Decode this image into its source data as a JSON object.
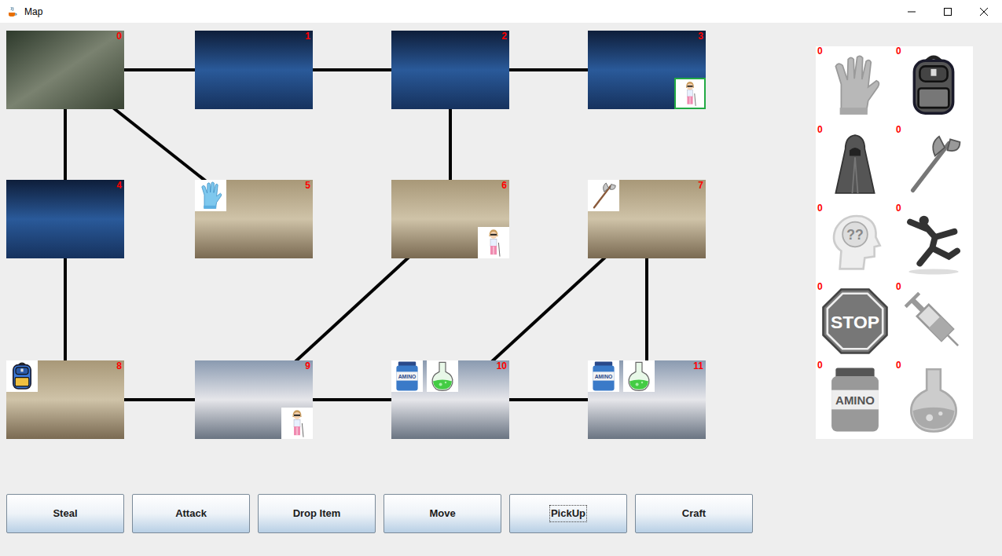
{
  "window": {
    "title": "Map"
  },
  "map": {
    "rooms": [
      {
        "number": "0",
        "kind": "city",
        "items": [],
        "players": []
      },
      {
        "number": "1",
        "kind": "lab",
        "items": [],
        "players": []
      },
      {
        "number": "2",
        "kind": "lab",
        "items": [],
        "players": []
      },
      {
        "number": "3",
        "kind": "lab",
        "items": [],
        "players": [
          {
            "selected": true
          }
        ]
      },
      {
        "number": "4",
        "kind": "lab",
        "items": [],
        "players": []
      },
      {
        "number": "5",
        "kind": "corridor",
        "items": [
          {
            "kind": "gloves"
          }
        ],
        "players": []
      },
      {
        "number": "6",
        "kind": "corridor",
        "items": [],
        "players": [
          {
            "selected": false
          }
        ]
      },
      {
        "number": "7",
        "kind": "corridor",
        "items": [
          {
            "kind": "axe"
          }
        ],
        "players": []
      },
      {
        "number": "8",
        "kind": "corridor",
        "items": [
          {
            "kind": "backpack"
          }
        ],
        "players": []
      },
      {
        "number": "9",
        "kind": "warehouse",
        "items": [],
        "players": [
          {
            "selected": false
          }
        ]
      },
      {
        "number": "10",
        "kind": "warehouse",
        "items": [
          {
            "kind": "amino",
            "label": "AMINO"
          },
          {
            "kind": "flask"
          }
        ],
        "players": []
      },
      {
        "number": "11",
        "kind": "warehouse",
        "items": [
          {
            "kind": "amino",
            "label": "AMINO"
          },
          {
            "kind": "flask"
          }
        ],
        "players": []
      }
    ],
    "edges": [
      [
        0,
        1
      ],
      [
        1,
        2
      ],
      [
        2,
        3
      ],
      [
        0,
        4
      ],
      [
        0,
        5
      ],
      [
        2,
        6
      ],
      [
        4,
        8
      ],
      [
        8,
        9
      ],
      [
        9,
        10
      ],
      [
        10,
        11
      ],
      [
        6,
        9
      ],
      [
        7,
        10
      ],
      [
        7,
        11
      ]
    ]
  },
  "inventory": [
    {
      "kind": "gloves",
      "count": "0"
    },
    {
      "kind": "backpack",
      "count": "0"
    },
    {
      "kind": "cloak",
      "count": "0"
    },
    {
      "kind": "axe",
      "count": "0"
    },
    {
      "kind": "brain",
      "count": "0",
      "label": "??"
    },
    {
      "kind": "dancer",
      "count": "0"
    },
    {
      "kind": "stop",
      "count": "0",
      "label": "STOP"
    },
    {
      "kind": "syringe",
      "count": "0"
    },
    {
      "kind": "amino",
      "count": "0",
      "label": "AMINO"
    },
    {
      "kind": "flask",
      "count": "0"
    }
  ],
  "buttons": [
    {
      "label": "Steal",
      "focused": false
    },
    {
      "label": "Attack",
      "focused": false
    },
    {
      "label": "Drop Item",
      "focused": false
    },
    {
      "label": "Move",
      "focused": false
    },
    {
      "label": "PickUp",
      "focused": true
    },
    {
      "label": "Craft",
      "focused": false
    }
  ]
}
